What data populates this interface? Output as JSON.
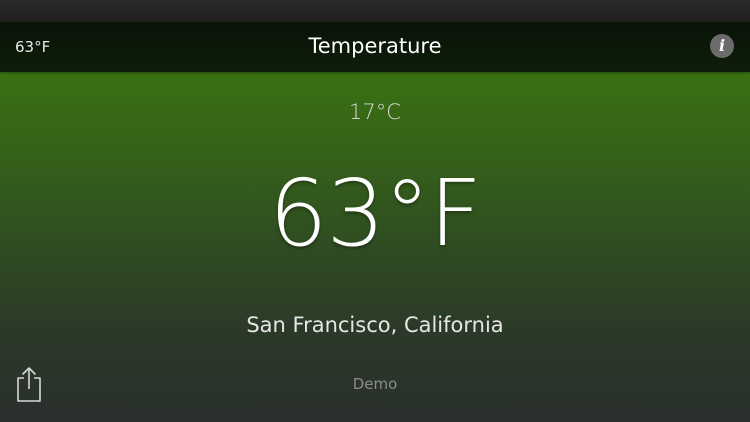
{
  "nav": {
    "left_label": "63°F",
    "title": "Temperature",
    "info_label": "i"
  },
  "main": {
    "celsius": "17°C",
    "fahrenheit": "63°F",
    "location": "San Francisco, California",
    "mode_label": "Demo"
  },
  "toolbar": {
    "share_icon": "share-icon"
  },
  "colors": {
    "gradient_top": "#3c7b10",
    "gradient_bottom": "#2a2f2d",
    "nav_background": "#0e1d09",
    "info_button": "#6b6b6b"
  }
}
